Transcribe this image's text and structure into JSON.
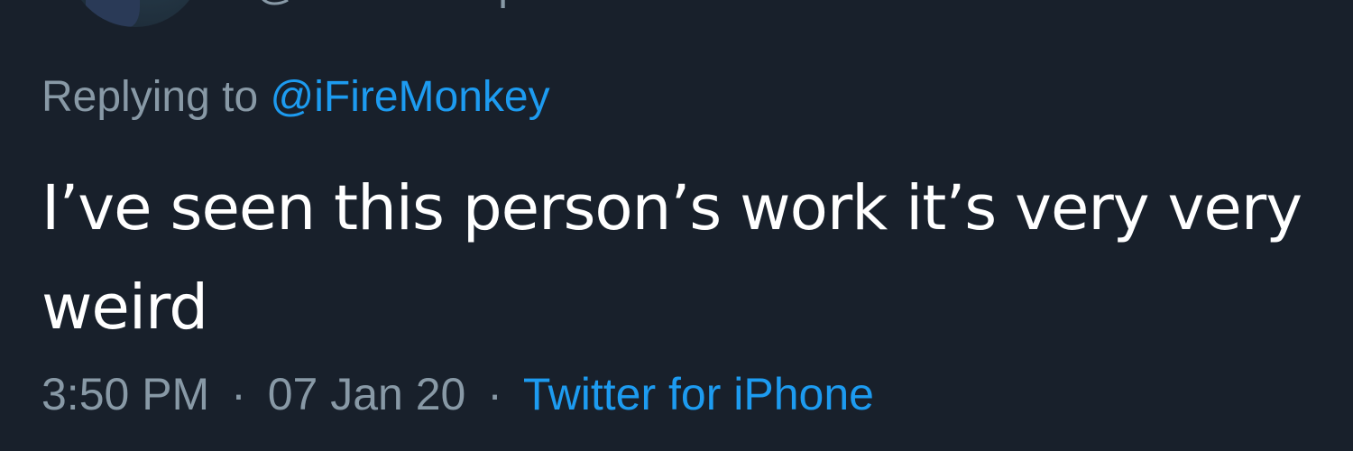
{
  "author": {
    "handle": "@itsdarkhoops"
  },
  "reply": {
    "prefix": "Replying to",
    "mention": "@iFireMonkey"
  },
  "tweet": {
    "text": "I’ve seen this person’s work it’s very very weird"
  },
  "meta": {
    "time": "3:50 PM",
    "separator": "·",
    "date": "07 Jan 20",
    "source": "Twitter for iPhone"
  },
  "colors": {
    "background": "#18202b",
    "muted": "#8899a6",
    "link": "#1d9bf0",
    "text": "#ffffff"
  }
}
